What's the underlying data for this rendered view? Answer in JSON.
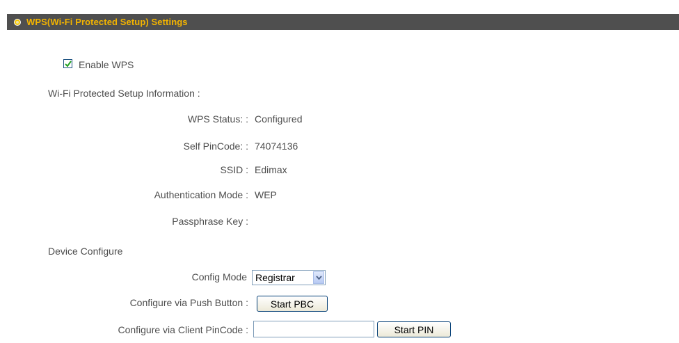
{
  "header": {
    "title": "WPS(Wi-Fi Protected Setup) Settings"
  },
  "enable_wps": {
    "label": "Enable WPS",
    "checked": true
  },
  "info": {
    "heading": "Wi-Fi Protected Setup Information :",
    "rows": [
      {
        "label": "WPS Status: :",
        "value": "Configured"
      },
      {
        "label": "Self PinCode: :",
        "value": "74074136"
      },
      {
        "label": "SSID :",
        "value": "Edimax"
      },
      {
        "label": "Authentication Mode :",
        "value": "WEP"
      },
      {
        "label": "Passphrase Key :",
        "value": ""
      }
    ]
  },
  "device": {
    "heading": "Device Configure",
    "config_mode_label": "Config Mode",
    "config_mode_value": "Registrar",
    "push_button_label": "Configure via Push Button :",
    "start_pbc": "Start PBC",
    "client_pin_label": "Configure via Client PinCode :",
    "client_pin_value": "",
    "start_pin": "Start PIN"
  },
  "colors": {
    "header_bg": "#4f4f4f",
    "header_text": "#f3b400"
  }
}
